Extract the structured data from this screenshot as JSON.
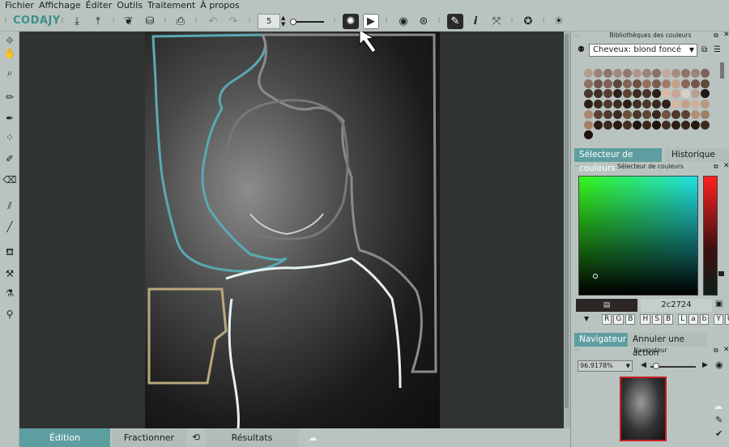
{
  "menu": [
    "Fichier",
    "Affichage",
    "Éditer",
    "Outils",
    "Traitement",
    "À propos"
  ],
  "toolbar": {
    "logo": "CODAJY",
    "brush_size": "5"
  },
  "canvas": {
    "description_tabs": {
      "edition": "Édition",
      "fractionner": "Fractionner",
      "resultats": "Résultats"
    }
  },
  "right_panel": {
    "libraries_title": "Bibliothèques des couleurs",
    "library_select": "Cheveux: blond foncé",
    "tab_selector": "Sélecteur de couleurs",
    "tab_history": "Historique des",
    "selector_title": "Sélecteur de couleurs",
    "hex_value": "2c2724",
    "modes": [
      "R",
      "G",
      "B",
      "H",
      "S",
      "B",
      "L",
      "a",
      "b",
      "Y",
      "U",
      "V"
    ],
    "tab_navigator": "Navigateur",
    "tab_undo": "Annuler une action",
    "navigator_title": "Navigateur",
    "zoom_value": "96.9178%"
  },
  "colors": {
    "accent_selected": "#5f9ea0",
    "region_blue": "#5aa8b4",
    "region_tan": "#b9a87e",
    "region_grey": "#8a8a8a",
    "nav_border": "#c52020"
  }
}
